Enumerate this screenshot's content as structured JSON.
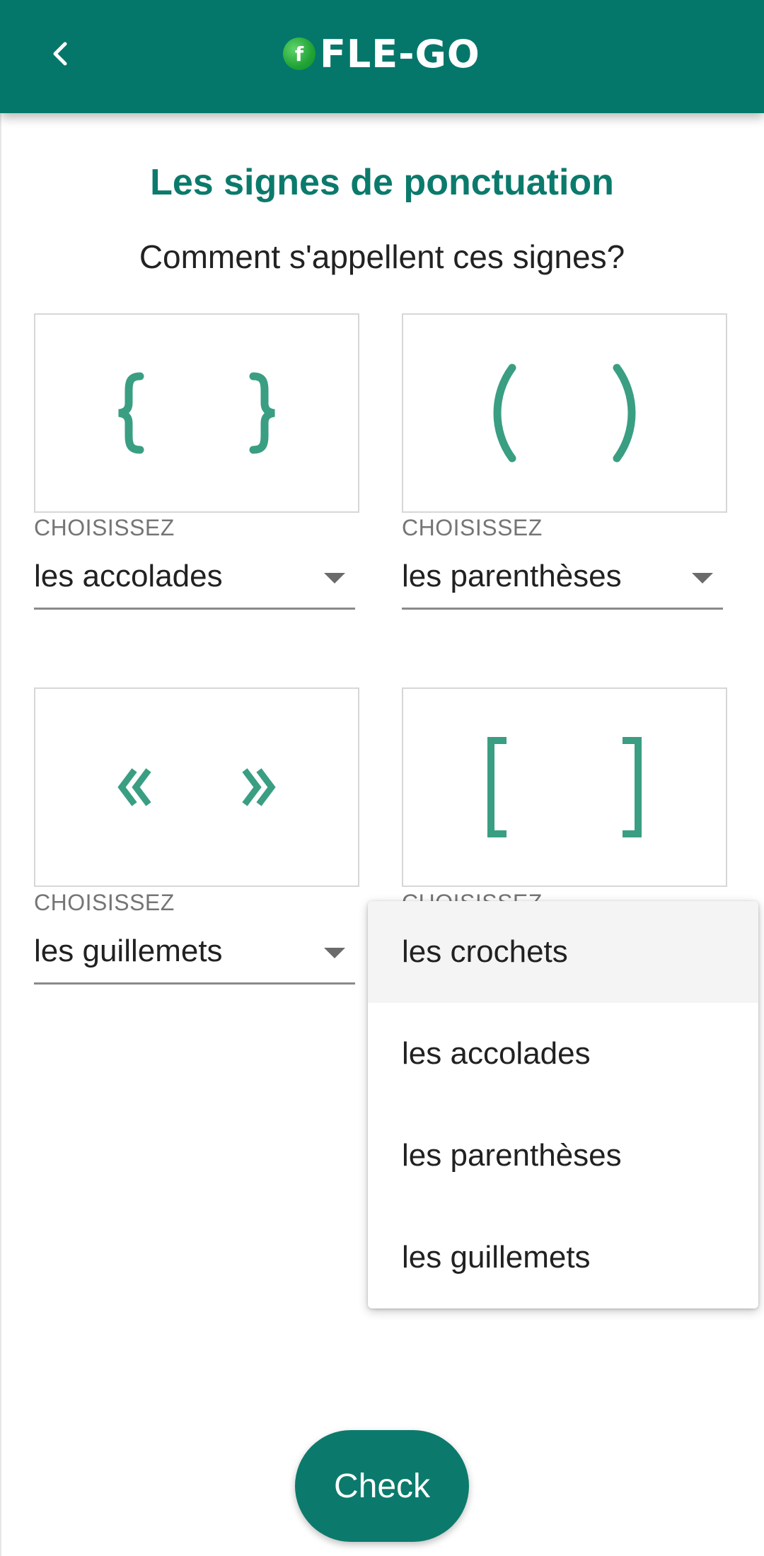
{
  "app": {
    "logo_badge": "f",
    "logo_text": "FLE-GO",
    "back_icon": "chevron-left-icon"
  },
  "page": {
    "title": "Les signes de ponctuation",
    "subtitle": "Comment s'appellent ces signes?"
  },
  "colors": {
    "primary": "#04776A",
    "title": "#0B7A6C",
    "glyph": "#3A9E82"
  },
  "questions": [
    {
      "glyph_icon": "curly-braces-icon",
      "label": "CHOISISSEZ",
      "value": "les accolades"
    },
    {
      "glyph_icon": "parentheses-icon",
      "label": "CHOISISSEZ",
      "value": "les parenthèses"
    },
    {
      "glyph_icon": "guillemets-icon",
      "label": "CHOISISSEZ",
      "value": "les guillemets"
    },
    {
      "glyph_icon": "square-brackets-icon",
      "label": "CHOISISSEZ",
      "value": ""
    }
  ],
  "dropdown": {
    "open_for": 4,
    "highlighted_index": 0,
    "options": [
      "les crochets",
      "les accolades",
      "les parenthèses",
      "les guillemets"
    ]
  },
  "check_button": {
    "label": "Check"
  }
}
